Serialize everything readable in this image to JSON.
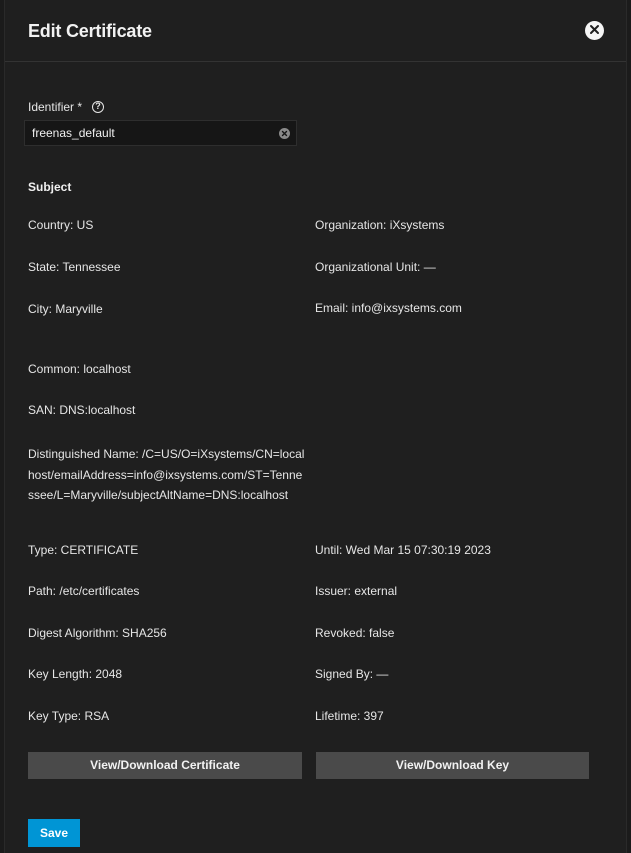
{
  "dialog": {
    "title": "Edit Certificate"
  },
  "identifier": {
    "label": "Identifier *",
    "value": "freenas_default"
  },
  "subject": {
    "heading": "Subject",
    "country": "Country: US",
    "organization": "Organization: iXsystems",
    "state": "State: Tennessee",
    "org_unit": "Organizational Unit: —",
    "city": "City: Maryville",
    "email": "Email: info@ixsystems.com",
    "common": "Common: localhost",
    "san": "SAN: DNS:localhost",
    "distinguished_name": "Distinguished Name: /C=US/O=iXsystems/CN=localhost/emailAddress=info@ixsystems.com/ST=Tennessee/L=Maryville/subjectAltName=DNS:localhost"
  },
  "details": {
    "type": "Type: CERTIFICATE",
    "until": "Until: Wed Mar 15 07:30:19 2023",
    "path": "Path: /etc/certificates",
    "issuer": "Issuer: external",
    "digest": "Digest Algorithm: SHA256",
    "revoked": "Revoked: false",
    "key_length": "Key Length: 2048",
    "signed_by": "Signed By: —",
    "key_type": "Key Type: RSA",
    "lifetime": "Lifetime: 397"
  },
  "buttons": {
    "view_cert": "View/Download Certificate",
    "view_key": "View/Download Key",
    "save": "Save"
  },
  "colors": {
    "background": "#1f1f1f",
    "button_gray": "#4a4a4a",
    "save_blue": "#0095d5"
  }
}
